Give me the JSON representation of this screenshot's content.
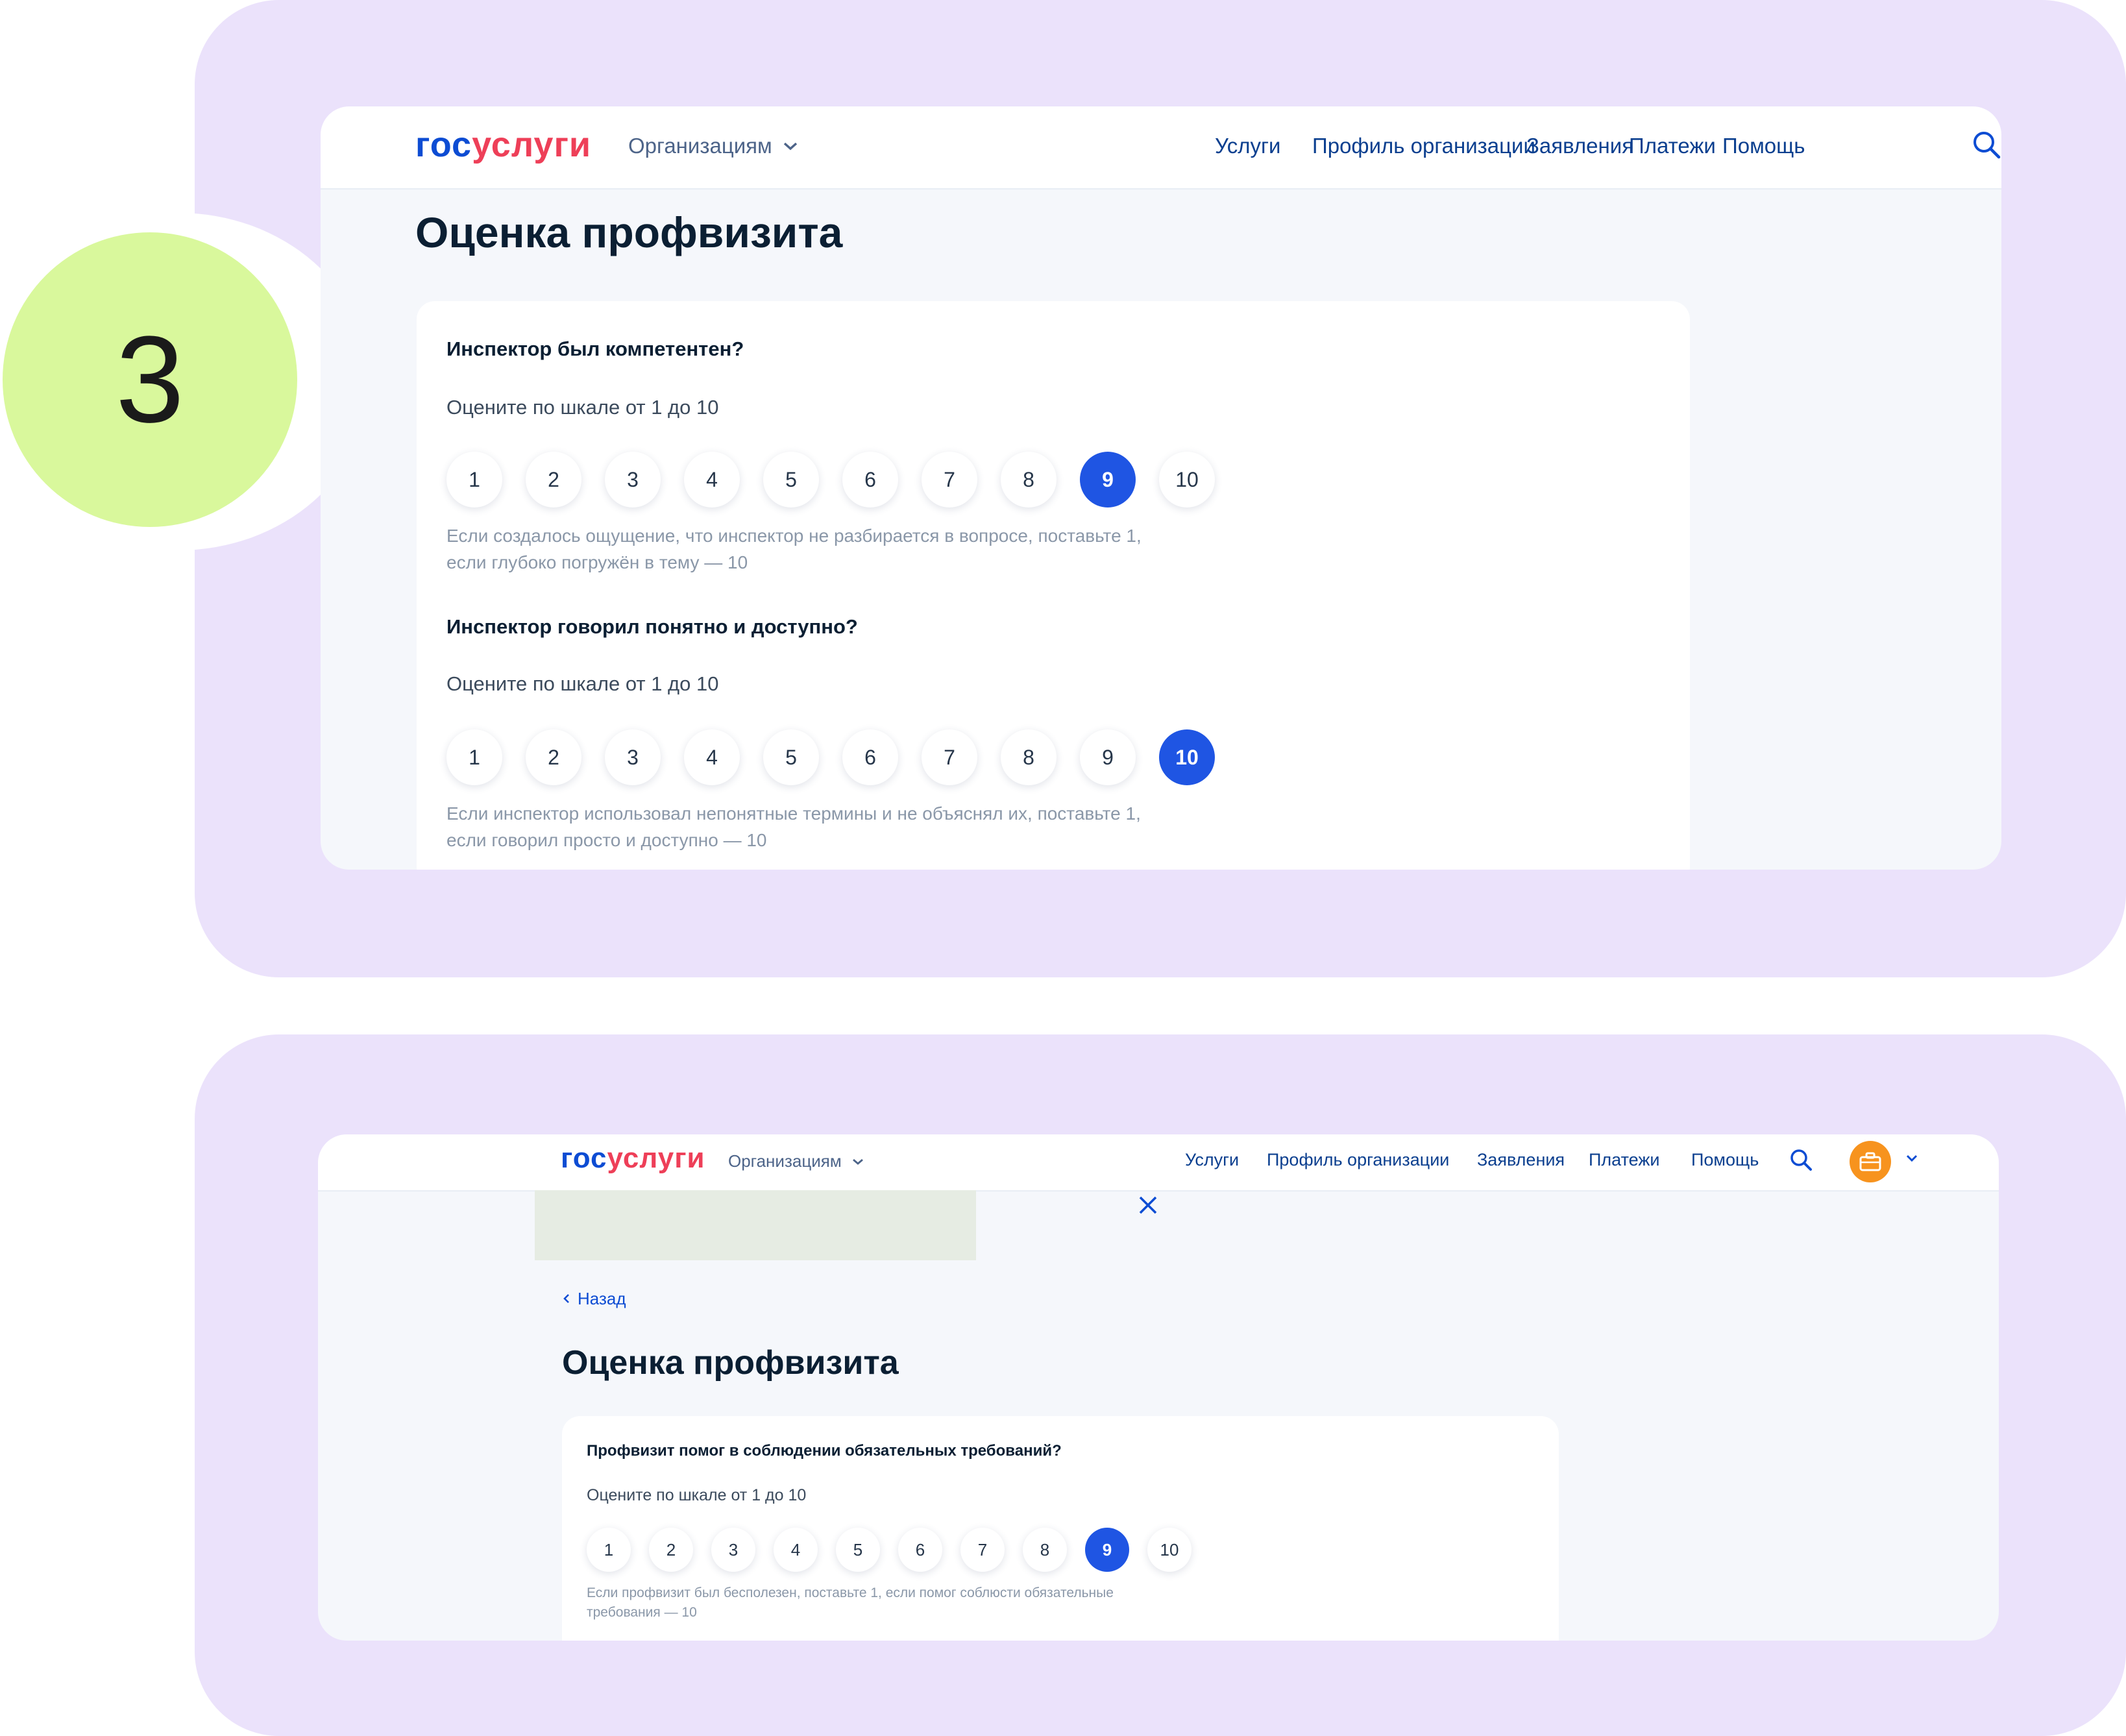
{
  "step": {
    "number": "3"
  },
  "colors": {
    "panel": "#ebe2fb",
    "step_circle": "#d9f89c",
    "accent": "#1f55e3",
    "logo_blue": "#0d4cd3",
    "logo_red": "#ee3f58",
    "avatar": "#f7931e"
  },
  "screen1": {
    "logo": {
      "part1": "гос",
      "part2": "услуги"
    },
    "org_menu": "Организациям",
    "nav": [
      "Услуги",
      "Профиль организации",
      "Заявления",
      "Платежи",
      "Помощь"
    ],
    "page_title": "Оценка профвизита",
    "questions": [
      {
        "title": "Инспектор был компетентен?",
        "subtitle": "Оцените по шкале от 1 до 10",
        "options": [
          "1",
          "2",
          "3",
          "4",
          "5",
          "6",
          "7",
          "8",
          "9",
          "10"
        ],
        "selected": "9",
        "hint_line1": "Если создалось ощущение, что инспектор не разбирается в вопросе, поставьте 1,",
        "hint_line2": "если глубоко погружён в тему — 10"
      },
      {
        "title": "Инспектор говорил понятно и доступно?",
        "subtitle": "Оцените по шкале от 1 до 10",
        "options": [
          "1",
          "2",
          "3",
          "4",
          "5",
          "6",
          "7",
          "8",
          "9",
          "10"
        ],
        "selected": "10",
        "hint_line1": "Если инспектор использовал непонятные термины и не объяснял их, поставьте 1,",
        "hint_line2": "если говорил просто и доступно — 10"
      }
    ]
  },
  "screen2": {
    "logo": {
      "part1": "гос",
      "part2": "услуги"
    },
    "org_menu": "Организациям",
    "nav": [
      "Услуги",
      "Профиль организации",
      "Заявления",
      "Платежи",
      "Помощь"
    ],
    "back": "Назад",
    "page_title": "Оценка профвизита",
    "question": {
      "title": "Профвизит помог в соблюдении обязательных требований?",
      "subtitle": "Оцените по шкале от 1 до 10",
      "options": [
        "1",
        "2",
        "3",
        "4",
        "5",
        "6",
        "7",
        "8",
        "9",
        "10"
      ],
      "selected": "9",
      "hint_line1": "Если профвизит был бесполезен, поставьте 1, если помог соблюсти обязательные",
      "hint_line2": "требования — 10"
    }
  },
  "icons": [
    "search-icon",
    "chevron-down-icon",
    "close-icon",
    "chevron-left-icon",
    "briefcase-icon"
  ]
}
